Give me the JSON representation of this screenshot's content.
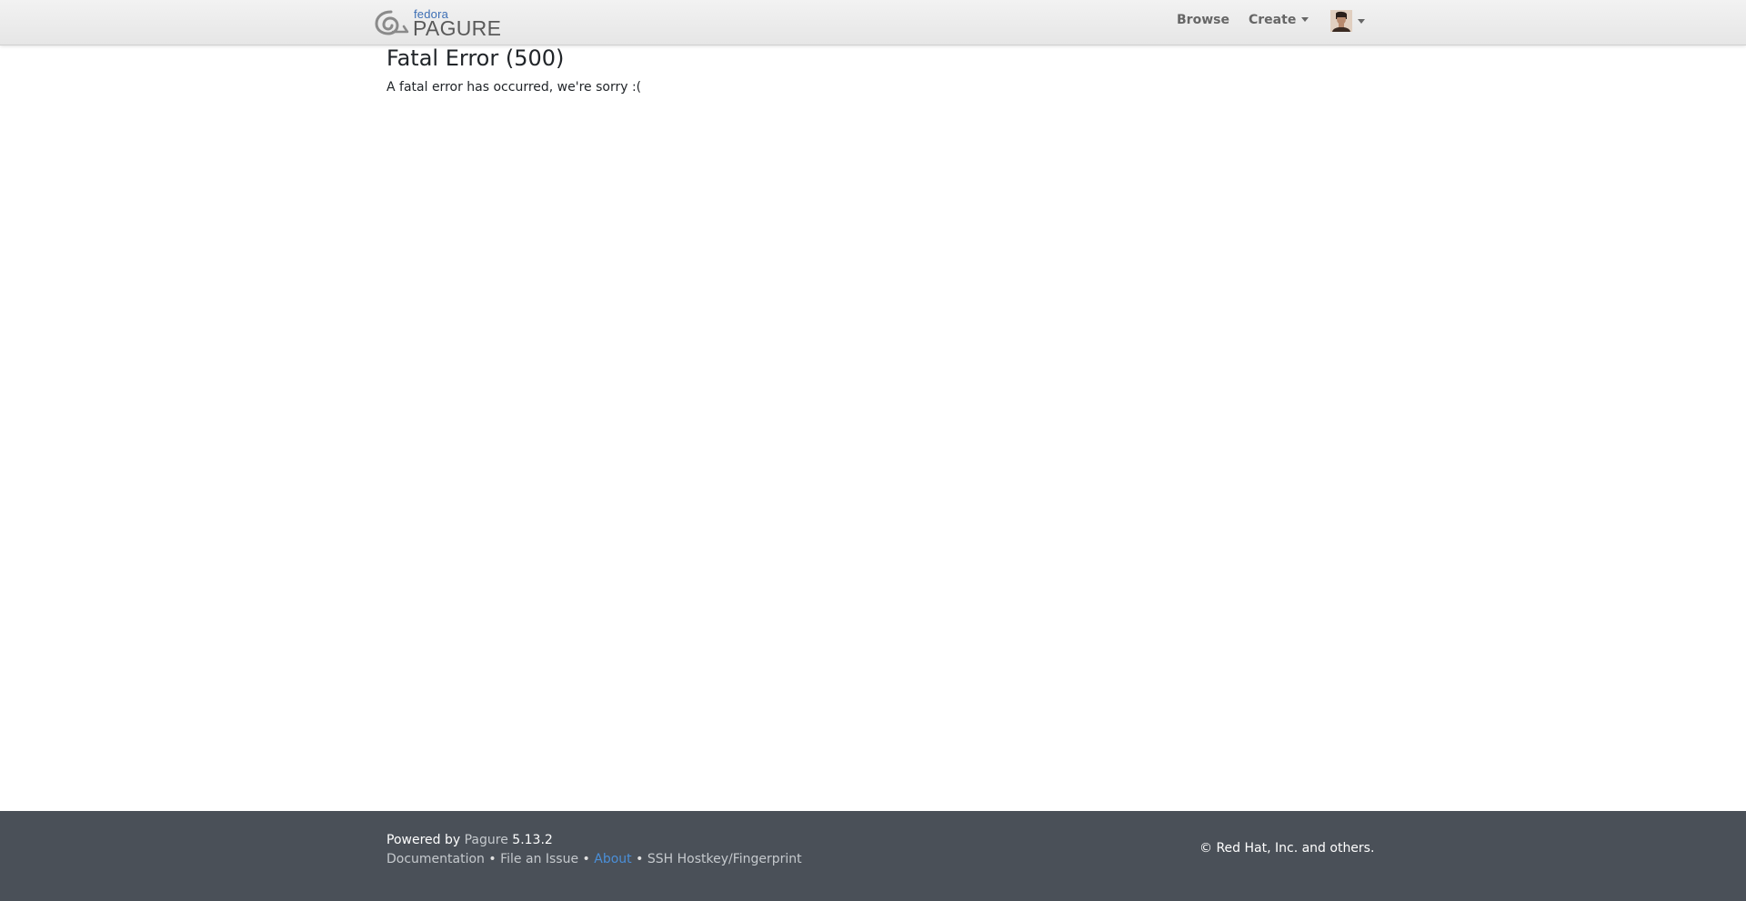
{
  "header": {
    "brand": {
      "small_text": "fedora",
      "big_text": "PAGURE"
    },
    "nav": {
      "browse_label": "Browse",
      "create_label": "Create"
    }
  },
  "main": {
    "title": "Fatal Error (500)",
    "message": "A fatal error has occurred, we're sorry :("
  },
  "footer": {
    "powered_by_prefix": "Powered by",
    "powered_by_link": "Pagure",
    "version": "5.13.2",
    "links": {
      "documentation": "Documentation",
      "file_issue": "File an Issue",
      "about": "About",
      "ssh": "SSH Hostkey/Fingerprint"
    },
    "separator": "•",
    "copyright": "© Red Hat, Inc. and others."
  },
  "colors": {
    "footer_bg": "#4a5058",
    "about_link": "#4a8fd8",
    "brand_blue": "#3c6eb4"
  }
}
